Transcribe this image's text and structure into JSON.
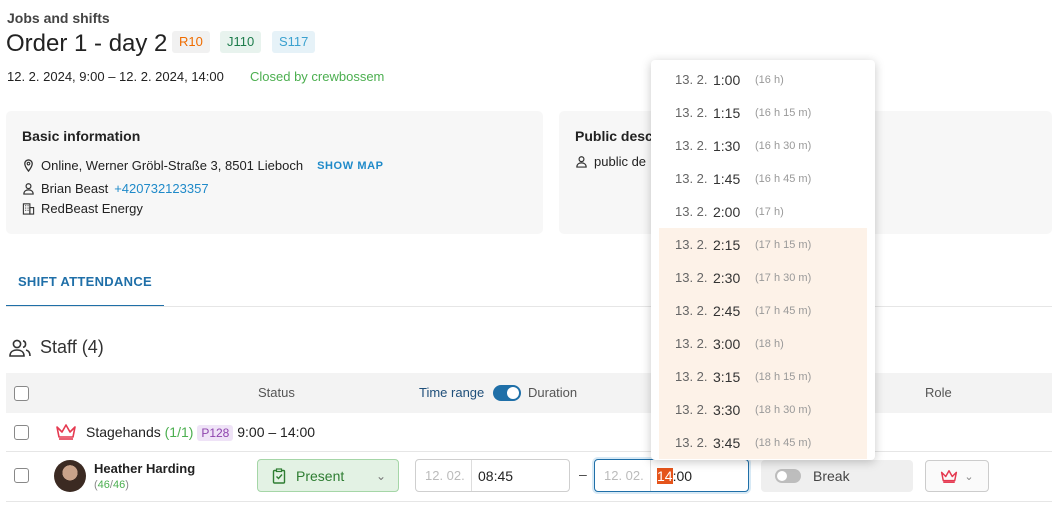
{
  "header": {
    "breadcrumb": "Jobs and shifts",
    "title": "Order 1 - day 2",
    "tags": [
      {
        "label": "R10",
        "color": "#ef6c00"
      },
      {
        "label": "J110",
        "color": "#1e7d4c"
      },
      {
        "label": "S117",
        "color": "#3ba1cf"
      }
    ],
    "date_range": "12. 2. 2024, 9:00 – 12. 2. 2024, 14:00",
    "closed_by": "Closed by crewbossem"
  },
  "basic_info": {
    "title": "Basic information",
    "location": "Online, Werner Gröbl-Straße 3, 8501 Lieboch",
    "show_map": "SHOW MAP",
    "contact_name": "Brian Beast",
    "contact_phone": "+420732123357",
    "company": "RedBeast Energy"
  },
  "public_desc": {
    "title": "Public desc",
    "text": "public de"
  },
  "tabs": {
    "shift_attendance": "SHIFT ATTENDANCE"
  },
  "staff": {
    "title": "Staff (4)"
  },
  "table": {
    "col_status": "Status",
    "col_time_range": "Time range",
    "col_duration": "Duration",
    "col_role": "Role"
  },
  "group": {
    "name": "Stagehands",
    "count": "(1/1)",
    "badge": "P128",
    "time": "9:00 – 14:00"
  },
  "person": {
    "name": "Heather Harding",
    "count_a": "46",
    "count_b": "46",
    "status": "Present",
    "start_date": "12. 02.",
    "start_time": "08:45",
    "end_date": "12. 02.",
    "end_time_hl": "14",
    "end_time_rest": ":00",
    "break_label": "Break"
  },
  "dropdown": {
    "options": [
      {
        "date": "13. 2.",
        "time": "1:00",
        "dur": "(16 h)",
        "highlighted": false
      },
      {
        "date": "13. 2.",
        "time": "1:15",
        "dur": "(16 h 15 m)",
        "highlighted": false
      },
      {
        "date": "13. 2.",
        "time": "1:30",
        "dur": "(16 h 30 m)",
        "highlighted": false
      },
      {
        "date": "13. 2.",
        "time": "1:45",
        "dur": "(16 h 45 m)",
        "highlighted": false
      },
      {
        "date": "13. 2.",
        "time": "2:00",
        "dur": "(17 h)",
        "highlighted": false
      },
      {
        "date": "13. 2.",
        "time": "2:15",
        "dur": "(17 h 15 m)",
        "highlighted": true
      },
      {
        "date": "13. 2.",
        "time": "2:30",
        "dur": "(17 h 30 m)",
        "highlighted": true
      },
      {
        "date": "13. 2.",
        "time": "2:45",
        "dur": "(17 h 45 m)",
        "highlighted": true
      },
      {
        "date": "13. 2.",
        "time": "3:00",
        "dur": "(18 h)",
        "highlighted": true
      },
      {
        "date": "13. 2.",
        "time": "3:15",
        "dur": "(18 h 15 m)",
        "highlighted": true
      },
      {
        "date": "13. 2.",
        "time": "3:30",
        "dur": "(18 h 30 m)",
        "highlighted": true
      },
      {
        "date": "13. 2.",
        "time": "3:45",
        "dur": "(18 h 45 m)",
        "highlighted": true
      }
    ]
  },
  "colors": {
    "accent": "#1f6fa8",
    "link": "#1f8ac9",
    "success": "#4caf50",
    "role_crown": "#e53950",
    "highlight": "#fdf2e8"
  }
}
